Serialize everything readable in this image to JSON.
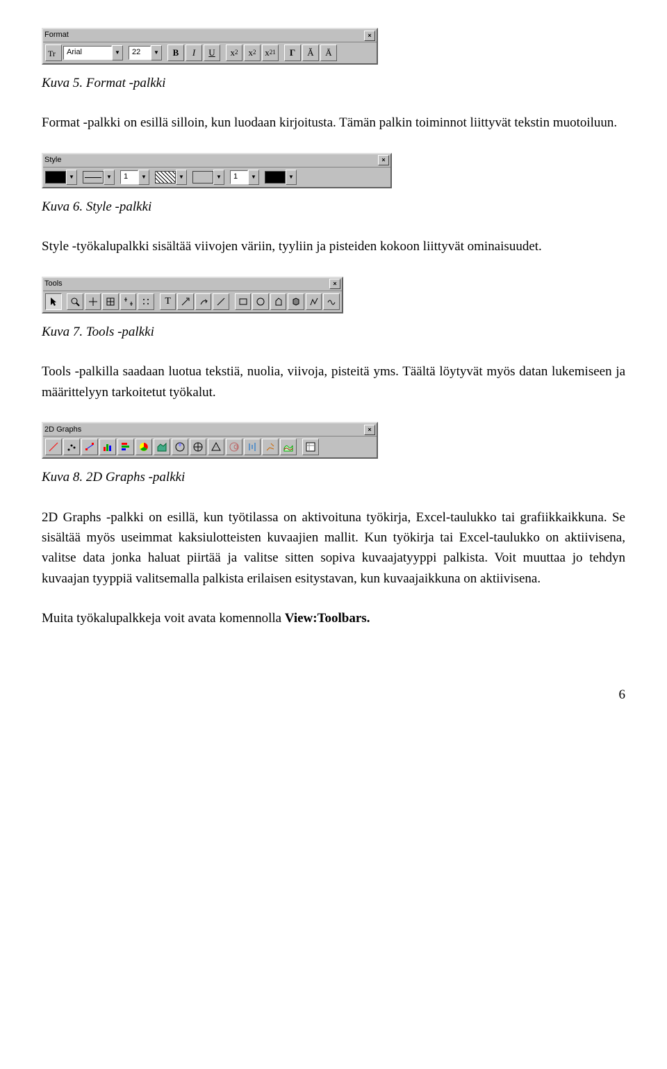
{
  "format_toolbar": {
    "title": "Format",
    "font_name": "Arial",
    "font_size": "22",
    "buttons": {
      "bold": "B",
      "italic": "I",
      "underline": "U",
      "superscript_html": "x<sup>2</sup>",
      "subscript_html": "x<sub>2</sub>",
      "supsubscript_html": "x<sup>2</sup><sub>1</sub>",
      "greek": "Γ",
      "increase_font_html": "Ǎ",
      "decrease_font_html": "Ā"
    }
  },
  "caption5": "Kuva 5. Format -palkki",
  "para_format": "Format -palkki on esillä silloin, kun luodaan kirjoitusta. Tämän palkin toiminnot liittyvät tekstin muotoiluun.",
  "style_toolbar": {
    "title": "Style",
    "line_width1": "1",
    "point_size": "1"
  },
  "caption6": "Kuva 6. Style -palkki",
  "para_style": "Style -työkalupalkki sisältää viivojen väriin, tyyliin ja pisteiden kokoon liittyvät ominaisuudet.",
  "tools_toolbar": {
    "title": "Tools"
  },
  "caption7": "Kuva 7. Tools -palkki",
  "para_tools": "Tools -palkilla saadaan luotua tekstiä, nuolia, viivoja, pisteitä yms. Täältä löytyvät myös datan lukemiseen ja määrittelyyn tarkoitetut työkalut.",
  "graphs_toolbar": {
    "title": "2D Graphs"
  },
  "caption8": "Kuva 8. 2D Graphs -palkki",
  "para_graphs": "2D Graphs -palkki on esillä, kun työtilassa on aktivoituna työkirja, Excel-taulukko tai grafiikkaikkuna. Se sisältää myös useimmat kaksiulotteisten kuvaajien mallit. Kun työkirja tai Excel-taulukko on aktiivisena, valitse data jonka haluat piirtää ja valitse sitten sopiva kuvaajatyyppi palkista. Voit muuttaa jo tehdyn kuvaajan tyyppiä valitsemalla palkista erilaisen esitystavan, kun kuvaajaikkuna on aktiivisena.",
  "para_final_pre": "Muita työkalupalkkeja voit avata komennolla ",
  "para_final_bold": "View:Toolbars.",
  "page_number": "6"
}
